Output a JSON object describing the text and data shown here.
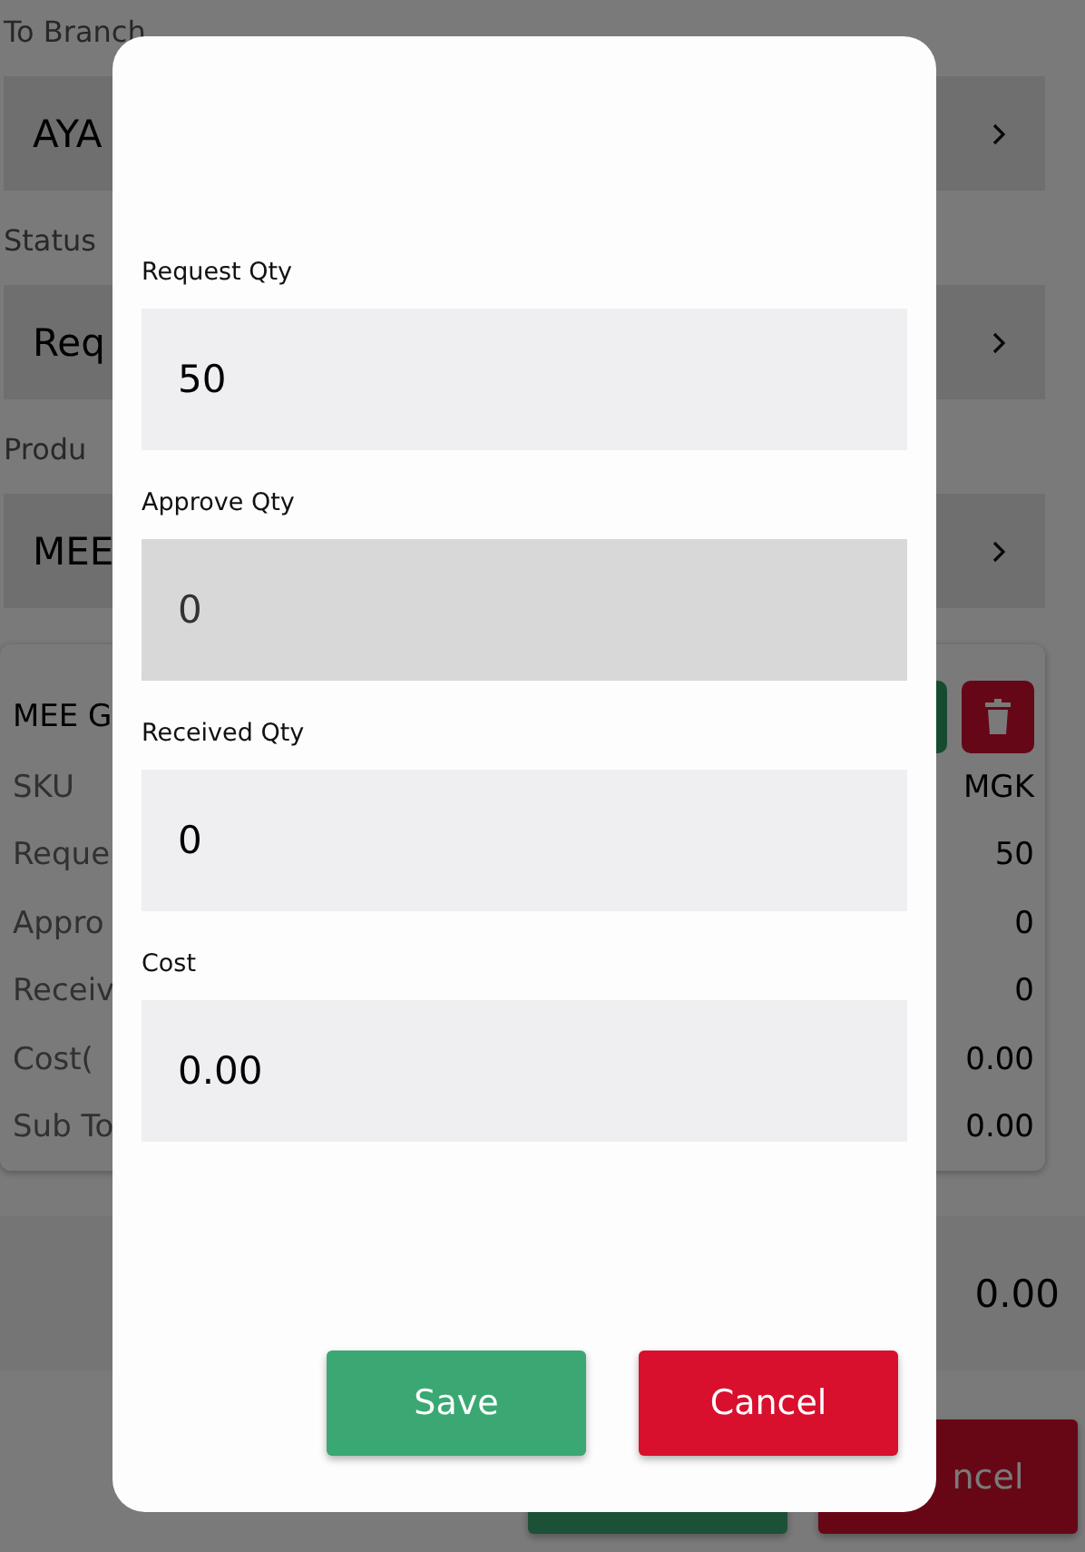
{
  "background": {
    "fields": [
      {
        "label": "To Branch",
        "value": "AYA"
      },
      {
        "label": "Status",
        "value": "Req"
      },
      {
        "label": "Produ",
        "value": "MEE"
      }
    ],
    "item": {
      "title": "MEE G",
      "rows": [
        {
          "label": "SKU",
          "value": "MGK"
        },
        {
          "label": "Reque",
          "value": "50"
        },
        {
          "label": "Appro",
          "value": "0"
        },
        {
          "label": "Receiv",
          "value": "0"
        },
        {
          "label": "Cost(",
          "value": "0.00"
        },
        {
          "label": "Sub To",
          "value": "0.00"
        }
      ]
    },
    "total": "0.00",
    "buttons": [
      {
        "kind": "confirm"
      },
      {
        "kind": "cancel",
        "label": "ncel"
      }
    ]
  },
  "dialog": {
    "fields": [
      {
        "label": "Request Qty",
        "value": "50",
        "disabled": false
      },
      {
        "label": "Approve  Qty",
        "value": "0",
        "disabled": true
      },
      {
        "label": "Received Qty",
        "value": "0",
        "disabled": false
      },
      {
        "label": "Cost",
        "value": "0.00",
        "disabled": false
      }
    ],
    "buttons": [
      {
        "label": "Save",
        "kind": "confirm"
      },
      {
        "label": "Cancel",
        "kind": "cancel"
      }
    ]
  }
}
